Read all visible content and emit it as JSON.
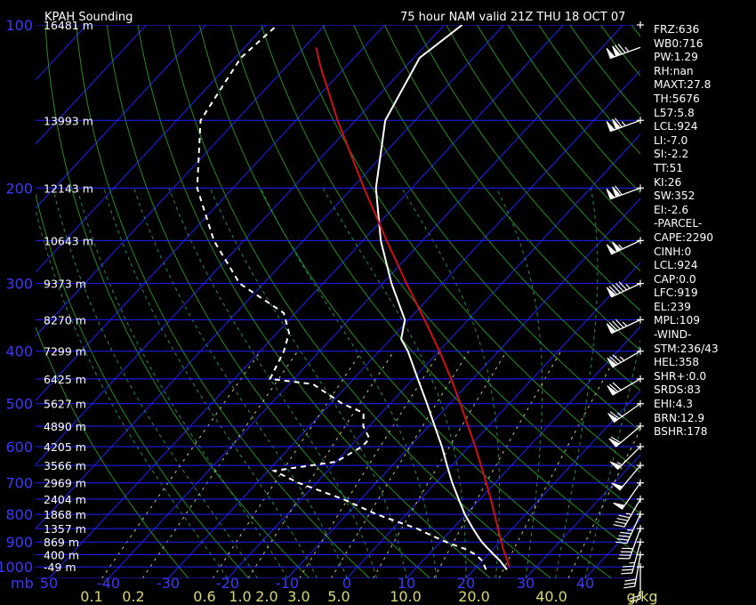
{
  "header": {
    "title": "KPAH Sounding",
    "valid": "75 hour NAM valid 21Z THU 18 OCT 07"
  },
  "stats": [
    "FRZ:636",
    "WB0:716",
    "PW:1.29",
    "RH:nan",
    "MAXT:27.8",
    "TH:5676",
    "L57:5.8",
    "LCL:924",
    "LI:-7.0",
    "SI:-2.2",
    "TT:51",
    "KI:26",
    "SW:352",
    "EI:-2.6",
    "-PARCEL-",
    "CAPE:2290",
    "CINH:0",
    "LCL:924",
    "CAP:0.0",
    "LFC:919",
    "EL:239",
    "MPL:109",
    "-WIND-",
    "STM:236/43",
    "HEL:358",
    "SHR+:0.0",
    "SRDS:83",
    "EHI:4.3",
    "BRN:12.9",
    "BSHR:178"
  ],
  "chart_data": {
    "type": "line",
    "title": "KPAH Sounding",
    "subtitle": "75 hour NAM valid 21Z THU 18 OCT 07",
    "y_unit_label": "mb",
    "pressure_ticks": [
      100,
      200,
      300,
      400,
      500,
      600,
      700,
      800,
      900,
      1000
    ],
    "height_labels": [
      {
        "p": 100,
        "label": "16481 m"
      },
      {
        "p": 150,
        "label": "13993 m"
      },
      {
        "p": 200,
        "label": "12143 m"
      },
      {
        "p": 250,
        "label": "10643 m"
      },
      {
        "p": 300,
        "label": "9373 m"
      },
      {
        "p": 350,
        "label": "8270 m"
      },
      {
        "p": 400,
        "label": "7299 m"
      },
      {
        "p": 450,
        "label": "6425 m"
      },
      {
        "p": 500,
        "label": "5627 m"
      },
      {
        "p": 550,
        "label": "4890 m"
      },
      {
        "p": 600,
        "label": "4205 m"
      },
      {
        "p": 650,
        "label": "3566 m"
      },
      {
        "p": 700,
        "label": "2969 m"
      },
      {
        "p": 750,
        "label": "2404 m"
      },
      {
        "p": 800,
        "label": "1868 m"
      },
      {
        "p": 850,
        "label": "1357 m"
      },
      {
        "p": 900,
        "label": "869 m"
      },
      {
        "p": 950,
        "label": "400 m"
      },
      {
        "p": 1000,
        "label": "-49 m"
      }
    ],
    "temp_ticks": [
      -50,
      -40,
      -30,
      -20,
      -10,
      0,
      10,
      20,
      30,
      40
    ],
    "temp_tick_labels": [
      "50",
      "-40",
      "-30",
      "-20",
      "-10",
      "0",
      "10",
      "20",
      "30",
      "40"
    ],
    "mixing_ratio_labels": [
      "0.1",
      "0.2",
      "0.6",
      "1.0",
      "2.0",
      "3.0",
      "5.0",
      "10.0",
      "20.0",
      "40.0",
      "g/kg"
    ],
    "mixing_ratios": [
      0.1,
      0.2,
      0.6,
      1.0,
      2.0,
      3.0,
      5.0,
      10.0,
      20.0,
      40.0
    ],
    "xlim": [
      -50,
      50
    ],
    "ylim": [
      100,
      1050
    ],
    "series": [
      {
        "role": "temperature",
        "color": "#ffffff",
        "style": "solid",
        "points": [
          [
            1012,
            25.5
          ],
          [
            975,
            23
          ],
          [
            950,
            21
          ],
          [
            925,
            19
          ],
          [
            900,
            17
          ],
          [
            875,
            15.2
          ],
          [
            850,
            13.4
          ],
          [
            800,
            9.8
          ],
          [
            750,
            6.4
          ],
          [
            700,
            2.8
          ],
          [
            650,
            -0.8
          ],
          [
            600,
            -4.6
          ],
          [
            550,
            -9
          ],
          [
            500,
            -13.8
          ],
          [
            450,
            -19.2
          ],
          [
            400,
            -25.2
          ],
          [
            380,
            -28.2
          ],
          [
            350,
            -30.6
          ],
          [
            300,
            -38.5
          ],
          [
            250,
            -47
          ],
          [
            200,
            -56
          ],
          [
            150,
            -65
          ],
          [
            115,
            -69
          ],
          [
            100,
            -67
          ]
        ]
      },
      {
        "role": "dewpoint",
        "color": "#ffffff",
        "style": "dashed",
        "points": [
          [
            1012,
            22
          ],
          [
            975,
            20
          ],
          [
            950,
            18
          ],
          [
            925,
            15
          ],
          [
            900,
            11
          ],
          [
            875,
            7.5
          ],
          [
            850,
            4
          ],
          [
            800,
            -5
          ],
          [
            750,
            -13
          ],
          [
            700,
            -23
          ],
          [
            665,
            -29
          ],
          [
            640,
            -20
          ],
          [
            600,
            -18
          ],
          [
            580,
            -18
          ],
          [
            550,
            -21
          ],
          [
            520,
            -23
          ],
          [
            500,
            -28
          ],
          [
            460,
            -36
          ],
          [
            450,
            -44
          ],
          [
            400,
            -46
          ],
          [
            370,
            -48
          ],
          [
            340,
            -52
          ],
          [
            300,
            -64
          ],
          [
            250,
            -75
          ],
          [
            200,
            -86
          ],
          [
            150,
            -96
          ],
          [
            115,
            -99
          ],
          [
            100,
            -98
          ]
        ]
      },
      {
        "role": "parcel",
        "color": "#d01010",
        "style": "solid",
        "points": [
          [
            1000,
            25.5
          ],
          [
            924,
            21.5
          ],
          [
            900,
            20.3
          ],
          [
            850,
            17.6
          ],
          [
            800,
            14.8
          ],
          [
            750,
            11.8
          ],
          [
            700,
            8.5
          ],
          [
            650,
            4.9
          ],
          [
            600,
            1.0
          ],
          [
            550,
            -3.4
          ],
          [
            500,
            -8.2
          ],
          [
            450,
            -13.6
          ],
          [
            400,
            -19.9
          ],
          [
            350,
            -27.3
          ],
          [
            300,
            -36
          ],
          [
            250,
            -46
          ],
          [
            200,
            -58
          ],
          [
            150,
            -73
          ],
          [
            120,
            -84
          ],
          [
            110,
            -88
          ]
        ]
      }
    ],
    "wind_barbs": [
      {
        "p": 110,
        "dir": 250,
        "spd": 125
      },
      {
        "p": 150,
        "dir": 250,
        "spd": 115
      },
      {
        "p": 200,
        "dir": 250,
        "spd": 110
      },
      {
        "p": 250,
        "dir": 245,
        "spd": 105
      },
      {
        "p": 300,
        "dir": 245,
        "spd": 95
      },
      {
        "p": 350,
        "dir": 245,
        "spd": 85
      },
      {
        "p": 400,
        "dir": 240,
        "spd": 75
      },
      {
        "p": 450,
        "dir": 240,
        "spd": 70
      },
      {
        "p": 500,
        "dir": 235,
        "spd": 65
      },
      {
        "p": 550,
        "dir": 230,
        "spd": 60
      },
      {
        "p": 600,
        "dir": 225,
        "spd": 55
      },
      {
        "p": 650,
        "dir": 220,
        "spd": 50
      },
      {
        "p": 700,
        "dir": 215,
        "spd": 50
      },
      {
        "p": 750,
        "dir": 210,
        "spd": 45
      },
      {
        "p": 800,
        "dir": 205,
        "spd": 45
      },
      {
        "p": 850,
        "dir": 200,
        "spd": 40
      },
      {
        "p": 900,
        "dir": 195,
        "spd": 35
      },
      {
        "p": 950,
        "dir": 190,
        "spd": 30
      },
      {
        "p": 1000,
        "dir": 180,
        "spd": 20
      }
    ],
    "colors": {
      "isobar": "#2020ff",
      "isotherm": "#2020ff",
      "dry_adiabat": "#1f8f1f",
      "moist_adiabat": "#1a8f5a",
      "mixing_ratio": "#c8c86e",
      "axis_text": "#3a3aff",
      "mixing_text": "#d8d870",
      "text": "#ffffff"
    }
  }
}
